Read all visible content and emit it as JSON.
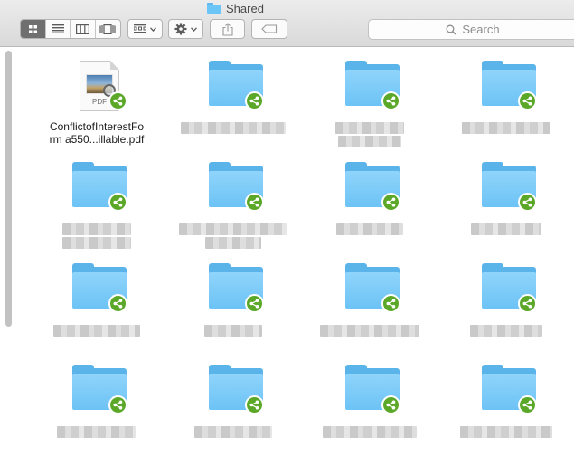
{
  "window": {
    "title": "Shared"
  },
  "toolbar": {
    "view_buttons": [
      {
        "name": "icon-view-button",
        "icon": "icon-grid-icon",
        "active": true
      },
      {
        "name": "list-view-button",
        "icon": "list-icon",
        "active": false
      },
      {
        "name": "column-view-button",
        "icon": "columns-icon",
        "active": false
      },
      {
        "name": "gallery-view-button",
        "icon": "cover-flow-icon",
        "active": false
      }
    ],
    "arrange_icon": "arrange-grid-icon",
    "action_icon": "gear-icon",
    "share_icon": "share-icon",
    "tag_icon": "tag-icon"
  },
  "search": {
    "placeholder": "Search",
    "icon": "search-icon"
  },
  "files": [
    {
      "name": "ConflictofInterestForm a550...illable.pdf",
      "line1": "ConflictofInterestFo",
      "line2": "rm a550...illable.pdf",
      "type": "pdf",
      "shared": true
    },
    {
      "type": "folder",
      "shared": true,
      "redacted": true
    },
    {
      "type": "folder",
      "shared": true,
      "redacted": true
    },
    {
      "type": "folder",
      "shared": true,
      "redacted": true
    },
    {
      "type": "folder",
      "shared": true,
      "redacted": true
    },
    {
      "type": "folder",
      "shared": true,
      "redacted": true
    },
    {
      "type": "folder",
      "shared": true,
      "redacted": true
    },
    {
      "type": "folder",
      "shared": true,
      "redacted": true
    },
    {
      "type": "folder",
      "shared": true,
      "redacted": true
    },
    {
      "type": "folder",
      "shared": true,
      "redacted": true
    },
    {
      "type": "folder",
      "shared": true,
      "redacted": true
    },
    {
      "type": "folder",
      "shared": true,
      "redacted": true
    },
    {
      "type": "folder",
      "shared": true,
      "redacted": true
    },
    {
      "type": "folder",
      "shared": true,
      "redacted": true
    },
    {
      "type": "folder",
      "shared": true,
      "redacted": true
    },
    {
      "type": "folder",
      "shared": true,
      "redacted": true
    }
  ],
  "colors": {
    "folder": "#6dc3f5",
    "share_badge": "#5ba829",
    "selected_view": "#6f6f6f"
  }
}
